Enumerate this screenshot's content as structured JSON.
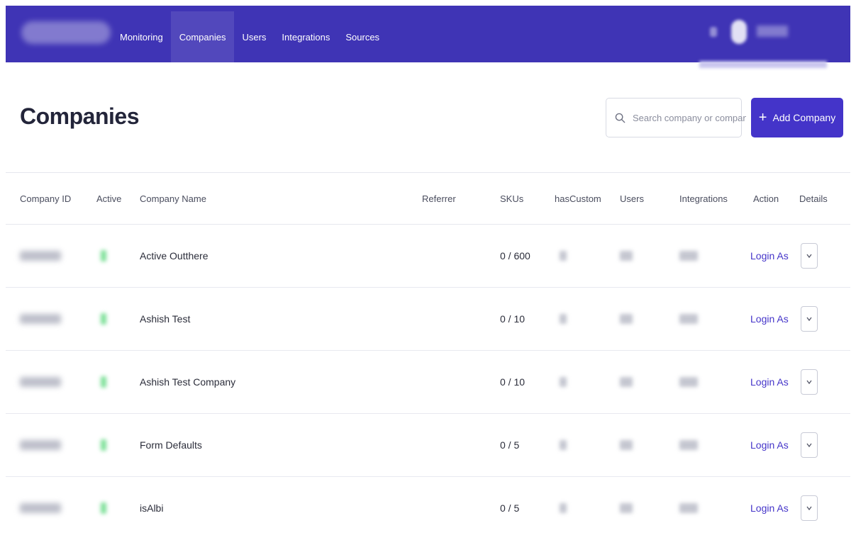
{
  "nav": {
    "items": [
      {
        "label": "Monitoring"
      },
      {
        "label": "Companies",
        "active": true
      },
      {
        "label": "Users"
      },
      {
        "label": "Integrations"
      },
      {
        "label": "Sources"
      }
    ]
  },
  "page": {
    "title": "Companies",
    "search_placeholder": "Search company or company",
    "add_button_label": "Add Company"
  },
  "table": {
    "columns": [
      "Company ID",
      "Active",
      "Company Name",
      "Referrer",
      "SKUs",
      "hasCustom",
      "Users",
      "Integrations",
      "Action",
      "Details"
    ],
    "rows": [
      {
        "name": "Active Outthere",
        "skus": "0 / 600",
        "action": "Login As"
      },
      {
        "name": "Ashish Test",
        "skus": "0 / 10",
        "action": "Login As"
      },
      {
        "name": "Ashish Test Company",
        "skus": "0 / 10",
        "action": "Login As"
      },
      {
        "name": "Form Defaults",
        "skus": "0 / 5",
        "action": "Login As"
      },
      {
        "name": "isAlbi",
        "skus": "0 / 5",
        "action": "Login As"
      }
    ]
  },
  "colors": {
    "brand": "#3f34b5",
    "button": "#4434c9",
    "active_indicator": "#7fe09a"
  }
}
